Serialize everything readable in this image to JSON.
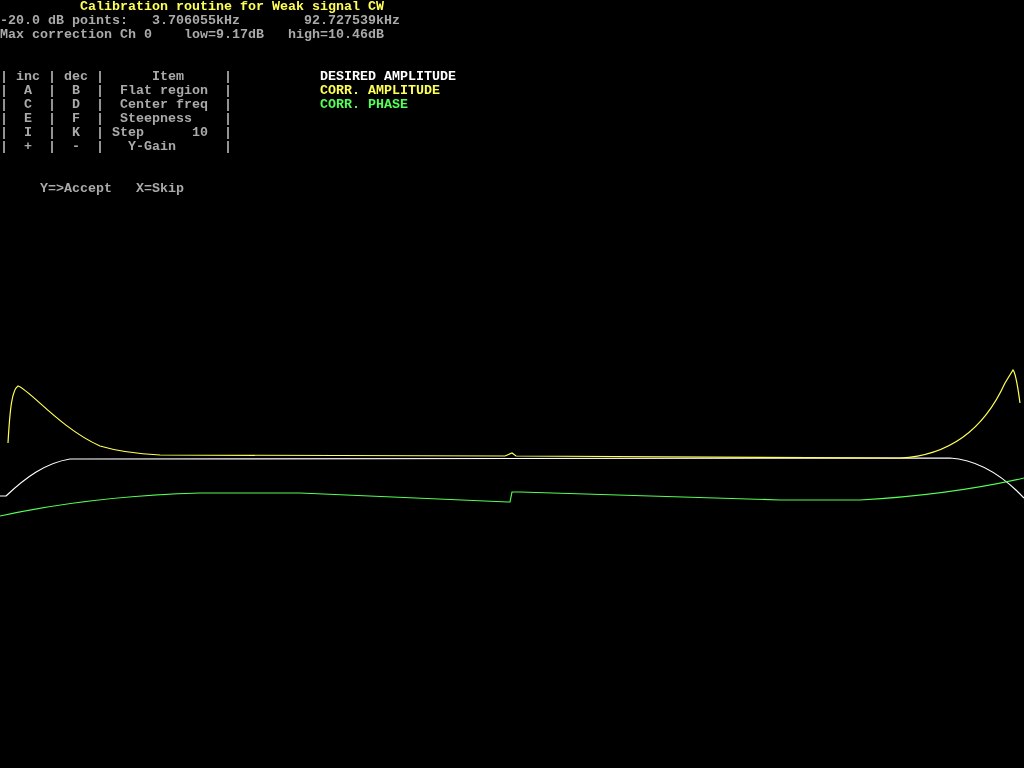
{
  "title": "Calibration routine for Weak signal CW",
  "points": {
    "label": "-20.0 dB points:",
    "low": "3.706055kHz",
    "high": "92.727539kHz"
  },
  "max_correction": {
    "label": "Max correction Ch 0",
    "low": "low=9.17dB",
    "high": "high=10.46dB"
  },
  "key_table": {
    "header": "| inc | dec |      Item     |",
    "rows": [
      "|  A  |  B  |  Flat region  |",
      "|  C  |  D  |  Center freq  |",
      "|  E  |  F  |  Steepness    |",
      "|  I  |  K  | Step      10  |",
      "|  +  |  -  |   Y-Gain      |"
    ]
  },
  "legend": [
    {
      "label": "DESIRED AMPLITUDE",
      "color": "#ffffff"
    },
    {
      "label": "CORR. AMPLITUDE",
      "color": "#ffff55"
    },
    {
      "label": "CORR. PHASE",
      "color": "#55ff55"
    }
  ],
  "hints": {
    "accept": "Y=>Accept",
    "skip": "X=Skip"
  }
}
